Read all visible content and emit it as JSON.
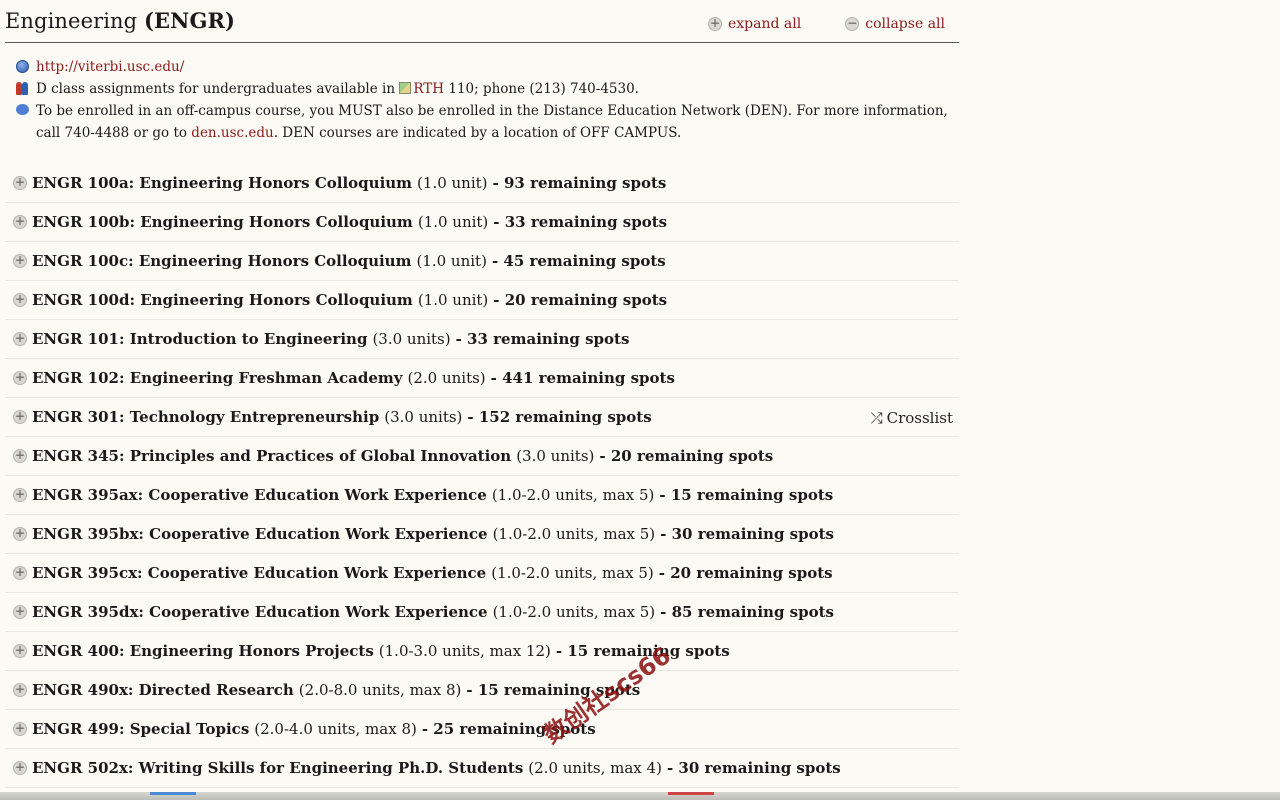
{
  "dept": {
    "title": "Engineering",
    "code": "(ENGR)"
  },
  "actions": {
    "expand_all": "expand all",
    "collapse_all": "collapse all"
  },
  "notes": {
    "url": "http://viterbi.usc.edu/",
    "class_assign_prefix": "D class assignments for undergraduates available in",
    "class_assign_link": "RTH",
    "class_assign_suffix": "110; phone (213) 740-4530.",
    "den_text_1": "To be enrolled in an off-campus course, you MUST also be enrolled in the Distance Education Network (DEN). For more information, call 740-4488 or go to",
    "den_link": "den.usc.edu",
    "den_text_2": ". DEN courses are indicated by a location of OFF CAMPUS."
  },
  "courses": [
    {
      "title": "ENGR 100a: Engineering Honors Colloquium",
      "units": "(1.0 unit)",
      "spots": "- 93 remaining spots"
    },
    {
      "title": "ENGR 100b: Engineering Honors Colloquium",
      "units": "(1.0 unit)",
      "spots": "- 33 remaining spots"
    },
    {
      "title": "ENGR 100c: Engineering Honors Colloquium",
      "units": "(1.0 unit)",
      "spots": "- 45 remaining spots"
    },
    {
      "title": "ENGR 100d: Engineering Honors Colloquium",
      "units": "(1.0 unit)",
      "spots": "- 20 remaining spots"
    },
    {
      "title": "ENGR 101: Introduction to Engineering",
      "units": "(3.0 units)",
      "spots": "- 33 remaining spots"
    },
    {
      "title": "ENGR 102: Engineering Freshman Academy",
      "units": "(2.0 units)",
      "spots": "- 441 remaining spots"
    },
    {
      "title": "ENGR 301: Technology Entrepreneurship",
      "units": "(3.0 units)",
      "spots": "- 152 remaining spots",
      "crosslist": "Crosslist"
    },
    {
      "title": "ENGR 345: Principles and Practices of Global Innovation",
      "units": "(3.0 units)",
      "spots": "- 20 remaining spots"
    },
    {
      "title": "ENGR 395ax: Cooperative Education Work Experience",
      "units": "(1.0-2.0 units, max 5)",
      "spots": "- 15 remaining spots"
    },
    {
      "title": "ENGR 395bx: Cooperative Education Work Experience",
      "units": "(1.0-2.0 units, max 5)",
      "spots": "- 30 remaining spots"
    },
    {
      "title": "ENGR 395cx: Cooperative Education Work Experience",
      "units": "(1.0-2.0 units, max 5)",
      "spots": "- 20 remaining spots"
    },
    {
      "title": "ENGR 395dx: Cooperative Education Work Experience",
      "units": "(1.0-2.0 units, max 5)",
      "spots": "- 85 remaining spots"
    },
    {
      "title": "ENGR 400: Engineering Honors Projects",
      "units": "(1.0-3.0 units, max 12)",
      "spots": "- 15 remaining spots"
    },
    {
      "title": "ENGR 490x: Directed Research",
      "units": "(2.0-8.0 units, max 8)",
      "spots": "- 15 remaining spots"
    },
    {
      "title": "ENGR 499: Special Topics",
      "units": "(2.0-4.0 units, max 8)",
      "spots": "- 25 remaining spots"
    },
    {
      "title": "ENGR 502x: Writing Skills for Engineering Ph.D. Students",
      "units": "(2.0 units, max 4)",
      "spots": "- 30 remaining spots"
    }
  ],
  "watermark": "数创社scs66"
}
